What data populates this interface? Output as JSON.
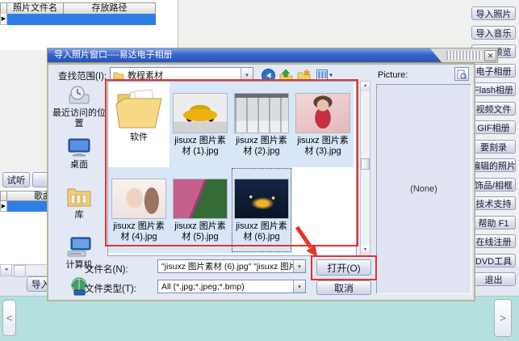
{
  "icons": {
    "close": "✕",
    "row_marker": "▶",
    "up_small": "▴",
    "down_small": "▾",
    "left_small": "◂",
    "chev_left": "<",
    "chev_right": ">",
    "dropdown": "▾"
  },
  "app": {
    "photo_table": {
      "col_file": "照片文件名",
      "col_path": "存放路径"
    },
    "song_table": {
      "col_song": "歌曲名"
    },
    "listen_button": "试听",
    "import_music_button": "导入音乐",
    "right_buttons": [
      "导入照片",
      "导入音乐",
      "效果预览",
      "电子相册",
      "Flash相册",
      "视频文件",
      "GIF相册",
      "要刻录",
      "编辑的照片",
      "饰品/相框",
      "技术支持",
      "帮助 F1",
      "在线注册",
      "DVD工具",
      "退出"
    ]
  },
  "dialog": {
    "title": "导入照片窗口----易达电子相册",
    "look_in_label": "查找范围(I):",
    "look_in_value": "教程素材",
    "sidebar": [
      "最近访问的位置",
      "桌面",
      "库",
      "计算机"
    ],
    "files": [
      {
        "name": "软件"
      },
      {
        "name": "jisuxz 图片素材 (1).jpg"
      },
      {
        "name": "jisuxz 图片素材 (2).jpg"
      },
      {
        "name": "jisuxz 图片素材 (3).jpg"
      },
      {
        "name": "jisuxz 图片素材 (4).jpg"
      },
      {
        "name": "jisuxz 图片素材 (5).jpg"
      },
      {
        "name": "jisuxz 图片素材 (6).jpg"
      }
    ],
    "file_name_label": "文件名(N):",
    "file_name_value": "\"jisuxz 图片素材 (6).jpg\" \"jisuxz 图片",
    "file_type_label": "文件类型(T):",
    "file_type_value": "All (*.jpg;*.jpeg;*.bmp)",
    "open_button": "打开(O)",
    "cancel_button": "取消",
    "picture_label": "Picture:",
    "preview_none": "(None)"
  },
  "colors": {
    "selection_blue": "#2e7fe5",
    "annotation_red": "#e2352b",
    "titlebar_blue": "#3667c8",
    "teal_bar": "#b4e1dd"
  }
}
